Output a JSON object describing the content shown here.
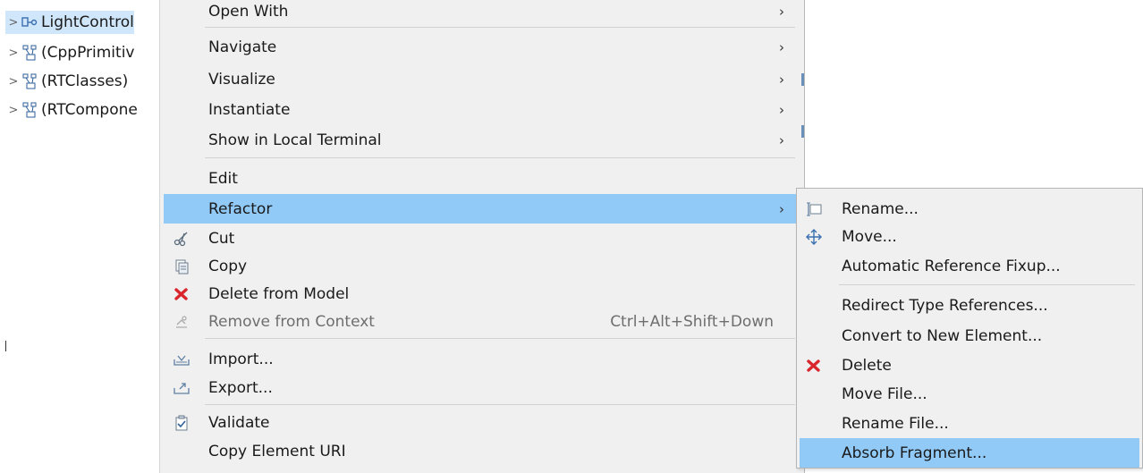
{
  "tree": {
    "items": [
      {
        "label": "LightControl",
        "icon": "capsule-icon",
        "selected": true
      },
      {
        "label": "(CppPrimitiv",
        "icon": "package-icon"
      },
      {
        "label": "(RTClasses)",
        "icon": "package-icon"
      },
      {
        "label": "(RTCompone",
        "icon": "package-icon"
      }
    ]
  },
  "menu": {
    "open_with": "Open With",
    "navigate": "Navigate",
    "visualize": "Visualize",
    "instantiate": "Instantiate",
    "show_in_local_terminal": "Show in Local Terminal",
    "edit": "Edit",
    "refactor": "Refactor",
    "cut": "Cut",
    "copy": "Copy",
    "delete_from_model": "Delete from Model",
    "remove_from_context": "Remove from Context",
    "remove_from_context_shortcut": "Ctrl+Alt+Shift+Down",
    "import": "Import...",
    "export": "Export...",
    "validate": "Validate",
    "copy_element_uri": "Copy Element URI",
    "arrow": "›"
  },
  "submenu": {
    "rename": "Rename...",
    "move": "Move...",
    "automatic_reference_fixup": "Automatic Reference Fixup...",
    "redirect_type_references": "Redirect Type References...",
    "convert_to_new_element": "Convert to New Element...",
    "delete": "Delete",
    "move_file": "Move File...",
    "rename_file": "Rename File...",
    "absorb_fragment": "Absorb Fragment..."
  },
  "colors": {
    "highlight": "#91c9f7",
    "tree_selected": "#cfe6fb",
    "menu_bg": "#f0f0f0",
    "delete_red": "#d9262c"
  }
}
